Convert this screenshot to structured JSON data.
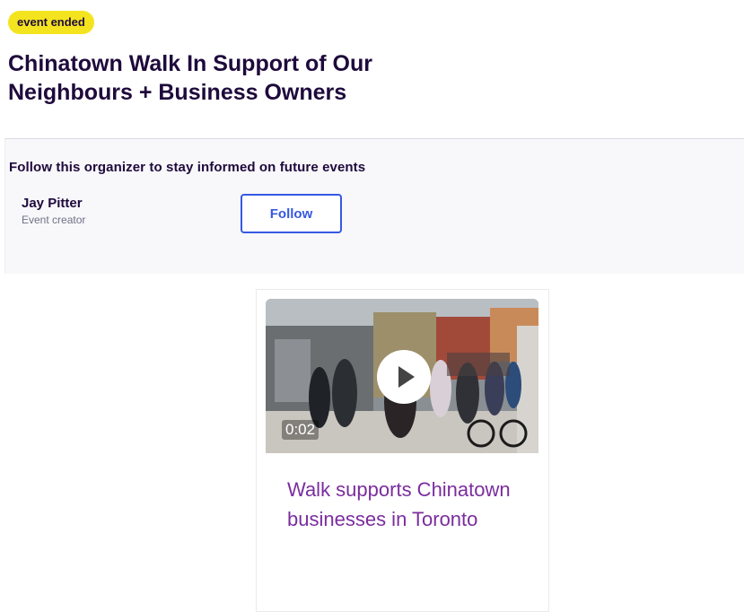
{
  "event": {
    "status_badge": "event ended",
    "title": "Chinatown Walk In Support of Our Neighbours + Business Owners"
  },
  "organizer": {
    "prompt": "Follow this organizer to stay informed on future events",
    "name": "Jay Pitter",
    "role": "Event creator",
    "follow_label": "Follow"
  },
  "video_card": {
    "duration": "0:02",
    "title": "Walk supports Chinatown businesses in Toronto"
  },
  "colors": {
    "badge": "#f4e41f",
    "title": "#1e0a3c",
    "follow_accent": "#3659e3",
    "video_title": "#7b2d9e"
  }
}
